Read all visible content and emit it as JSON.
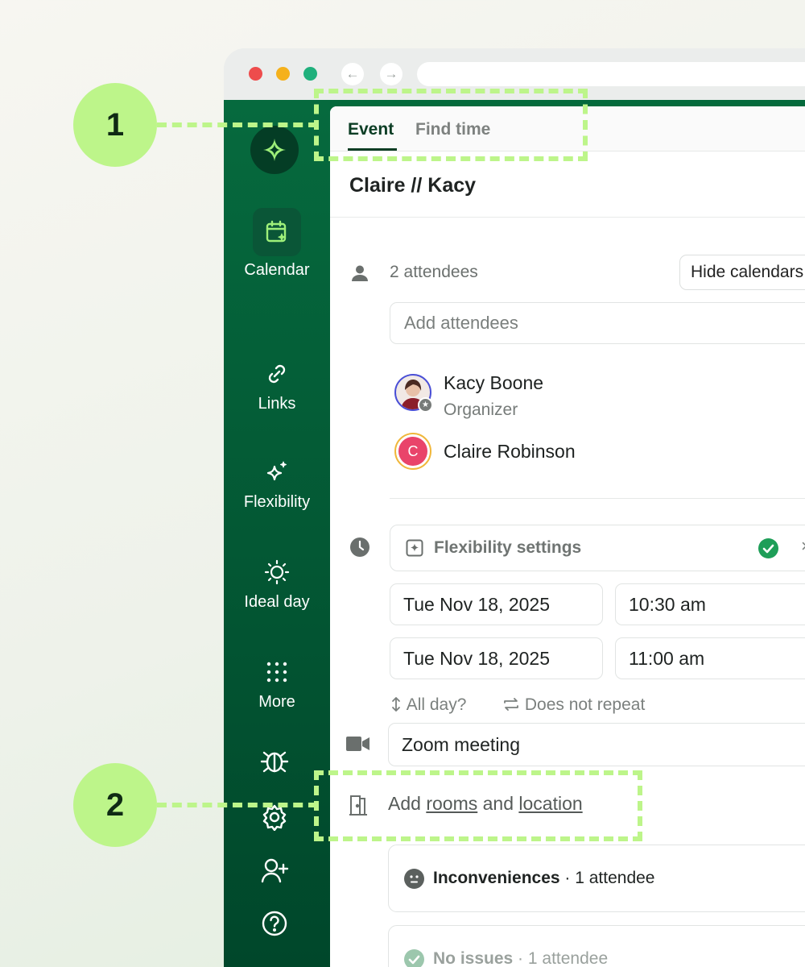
{
  "browser": {
    "back_glyph": "←",
    "forward_glyph": "→"
  },
  "sidebar": {
    "logo_icon": "reclaim-logo-icon",
    "items": [
      {
        "label": "Calendar",
        "icon": "calendar-icon"
      },
      {
        "label": "Links",
        "icon": "link-icon"
      },
      {
        "label": "Flexibility",
        "icon": "sparkles-icon"
      },
      {
        "label": "Ideal day",
        "icon": "sun-icon"
      },
      {
        "label": "More",
        "icon": "grid-dots-icon"
      }
    ],
    "bottom_icons": [
      "bug-icon",
      "settings-icon",
      "add-user-icon",
      "help-icon"
    ]
  },
  "tabs": {
    "event": "Event",
    "find_time": "Find time"
  },
  "event": {
    "title": "Claire // Kacy",
    "attendees_count": "2 attendees",
    "hide_calendars_button": "Hide calendars",
    "add_attendees_placeholder": "Add attendees",
    "attendees": [
      {
        "name": "Kacy Boone",
        "role": "Organizer",
        "kebab": "⋮"
      },
      {
        "name": "Claire Robinson",
        "initial": "C",
        "kebab": "⋮"
      }
    ],
    "flexibility_label": "Flexibility settings",
    "close_glyph": "×",
    "start_date": "Tue Nov 18, 2025",
    "start_time": "10:30 am",
    "end_date": "Tue Nov 18, 2025",
    "end_time": "11:00 am",
    "all_day": "All day?",
    "repeat": "Does not repeat",
    "conference": "Zoom meeting",
    "rooms": {
      "prefix": "Add ",
      "rooms_link": "rooms",
      "middle": " and ",
      "location_link": "location"
    },
    "inconveniences": {
      "title": "Inconveniences",
      "detail": " · 1 attendee"
    },
    "no_issues": {
      "title": "No issues",
      "detail": " · 1 attendee"
    }
  },
  "annotations": {
    "callout_1": "1",
    "callout_2": "2"
  },
  "colors": {
    "sidebar_green": "#046a3c",
    "accent_lime": "#bdf58a",
    "check_green": "#1e9e58"
  }
}
